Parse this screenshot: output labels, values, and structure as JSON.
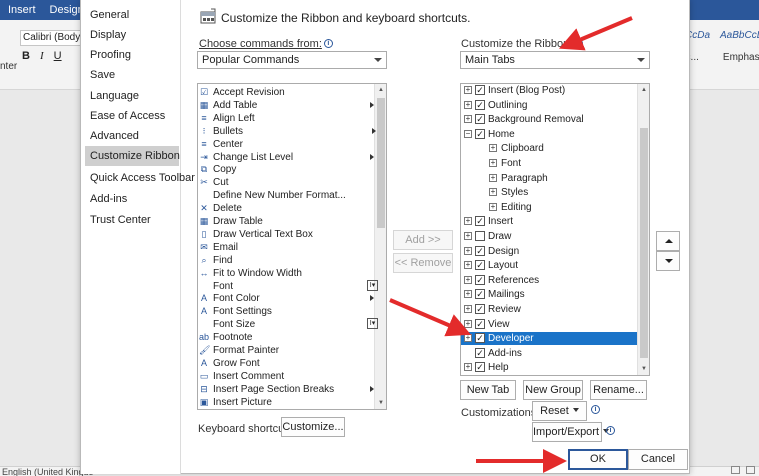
{
  "word": {
    "tabs": [
      "Insert",
      "Design"
    ],
    "font_name": "Calibri (Body)",
    "biu": [
      "B",
      "I",
      "U"
    ],
    "side_label": "nter",
    "styles": [
      "cCcDa",
      "AaBbCcDa"
    ],
    "style_names": [
      "ec...",
      "Emphasis"
    ],
    "status_text": "English (United Kingdo"
  },
  "nav": {
    "items": [
      "General",
      "Display",
      "Proofing",
      "Save",
      "Language",
      "Ease of Access",
      "Advanced",
      "Customize Ribbon",
      "Quick Access Toolbar",
      "Add-ins",
      "Trust Center"
    ],
    "selected_index": 7
  },
  "header": {
    "title": "Customize the Ribbon and keyboard shortcuts.",
    "icon": "ribbon-icon"
  },
  "left": {
    "label": "Choose commands from:",
    "combo_value": "Popular Commands",
    "commands": [
      {
        "label": "Accept Revision",
        "icon": "check-doc-icon"
      },
      {
        "label": "Add Table",
        "icon": "table-icon",
        "submenu": true
      },
      {
        "label": "Align Left",
        "icon": "align-left-icon"
      },
      {
        "label": "Bullets",
        "icon": "bullets-icon",
        "split": true
      },
      {
        "label": "Center",
        "icon": "center-icon"
      },
      {
        "label": "Change List Level",
        "icon": "list-level-icon",
        "submenu": true
      },
      {
        "label": "Copy",
        "icon": "copy-icon"
      },
      {
        "label": "Cut",
        "icon": "cut-icon"
      },
      {
        "label": "Define New Number Format...",
        "icon": ""
      },
      {
        "label": "Delete",
        "icon": "delete-icon"
      },
      {
        "label": "Draw Table",
        "icon": "draw-table-icon"
      },
      {
        "label": "Draw Vertical Text Box",
        "icon": "text-box-icon"
      },
      {
        "label": "Email",
        "icon": "email-icon"
      },
      {
        "label": "Find",
        "icon": "find-icon"
      },
      {
        "label": "Fit to Window Width",
        "icon": "fit-width-icon"
      },
      {
        "label": "Font",
        "icon": "",
        "dropdown": true
      },
      {
        "label": "Font Color",
        "icon": "font-color-icon",
        "submenu": true
      },
      {
        "label": "Font Settings",
        "icon": "font-settings-icon"
      },
      {
        "label": "Font Size",
        "icon": "",
        "dropdown": true
      },
      {
        "label": "Footnote",
        "icon": "footnote-icon"
      },
      {
        "label": "Format Painter",
        "icon": "format-painter-icon"
      },
      {
        "label": "Grow Font",
        "icon": "grow-font-icon"
      },
      {
        "label": "Insert Comment",
        "icon": "comment-icon"
      },
      {
        "label": "Insert Page  Section Breaks",
        "icon": "page-break-icon",
        "submenu": true
      },
      {
        "label": "Insert Picture",
        "icon": "picture-icon"
      }
    ],
    "keyboard_label": "Keyboard shortcuts:",
    "customize_btn": "Customize..."
  },
  "middle": {
    "add_btn": "Add >>",
    "remove_btn": "<< Remove"
  },
  "right": {
    "label": "Customize the Ribbon:",
    "combo_value": "Main Tabs",
    "tabs": [
      {
        "label": "Insert (Blog Post)",
        "level": 0,
        "checked": true,
        "expander": "+"
      },
      {
        "label": "Outlining",
        "level": 0,
        "checked": true,
        "expander": "+"
      },
      {
        "label": "Background Removal",
        "level": 0,
        "checked": true,
        "expander": "+"
      },
      {
        "label": "Home",
        "level": 0,
        "checked": true,
        "expander": "−"
      },
      {
        "label": "Clipboard",
        "level": 1,
        "expander": "+"
      },
      {
        "label": "Font",
        "level": 1,
        "expander": "+"
      },
      {
        "label": "Paragraph",
        "level": 1,
        "expander": "+"
      },
      {
        "label": "Styles",
        "level": 1,
        "expander": "+"
      },
      {
        "label": "Editing",
        "level": 1,
        "expander": "+"
      },
      {
        "label": "Insert",
        "level": 0,
        "checked": true,
        "expander": "+"
      },
      {
        "label": "Draw",
        "level": 0,
        "checked": false,
        "expander": "+"
      },
      {
        "label": "Design",
        "level": 0,
        "checked": true,
        "expander": "+"
      },
      {
        "label": "Layout",
        "level": 0,
        "checked": true,
        "expander": "+"
      },
      {
        "label": "References",
        "level": 0,
        "checked": true,
        "expander": "+"
      },
      {
        "label": "Mailings",
        "level": 0,
        "checked": true,
        "expander": "+"
      },
      {
        "label": "Review",
        "level": 0,
        "checked": true,
        "expander": "+"
      },
      {
        "label": "View",
        "level": 0,
        "checked": true,
        "expander": "+"
      },
      {
        "label": "Developer",
        "level": 0,
        "checked": true,
        "expander": "+",
        "selected": true
      },
      {
        "label": "Add-ins",
        "level": 0,
        "checked": true,
        "expander": ""
      },
      {
        "label": "Help",
        "level": 0,
        "checked": true,
        "expander": "+"
      }
    ],
    "new_tab": "New Tab",
    "new_group": "New Group",
    "rename": "Rename...",
    "customizations_label": "Customizations:",
    "reset": "Reset",
    "import_export": "Import/Export"
  },
  "footer": {
    "ok": "OK",
    "cancel": "Cancel"
  },
  "colors": {
    "selection": "#1a73c8",
    "accent": "#2b579a",
    "annotation": "#e32b2b"
  }
}
